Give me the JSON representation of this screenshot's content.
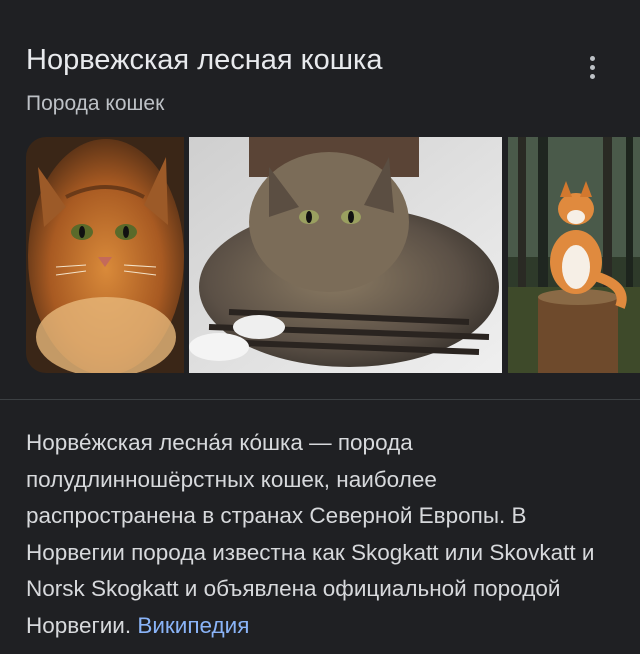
{
  "header": {
    "title": "Норвежская лесная кошка",
    "subtitle": "Порода кошек",
    "menu_icon": "more-vert-icon"
  },
  "gallery": {
    "images": [
      {
        "name": "cat-photo-1"
      },
      {
        "name": "cat-photo-2"
      },
      {
        "name": "cat-photo-3"
      }
    ]
  },
  "description": {
    "text": "Норве́жская лесна́я ко́шка — порода полудлинношёрстных кошек, наиболее распространена в странах Северной Европы. В Норвегии порода известна как Skogkatt или Skovkatt и Norsk Skogkatt и объявлена официальной породой Норвегии.",
    "source_link": "Википедия"
  },
  "colors": {
    "background": "#1f2023",
    "text": "#e8eaed",
    "secondary_text": "#bdc1c6",
    "link": "#8ab4f8"
  }
}
